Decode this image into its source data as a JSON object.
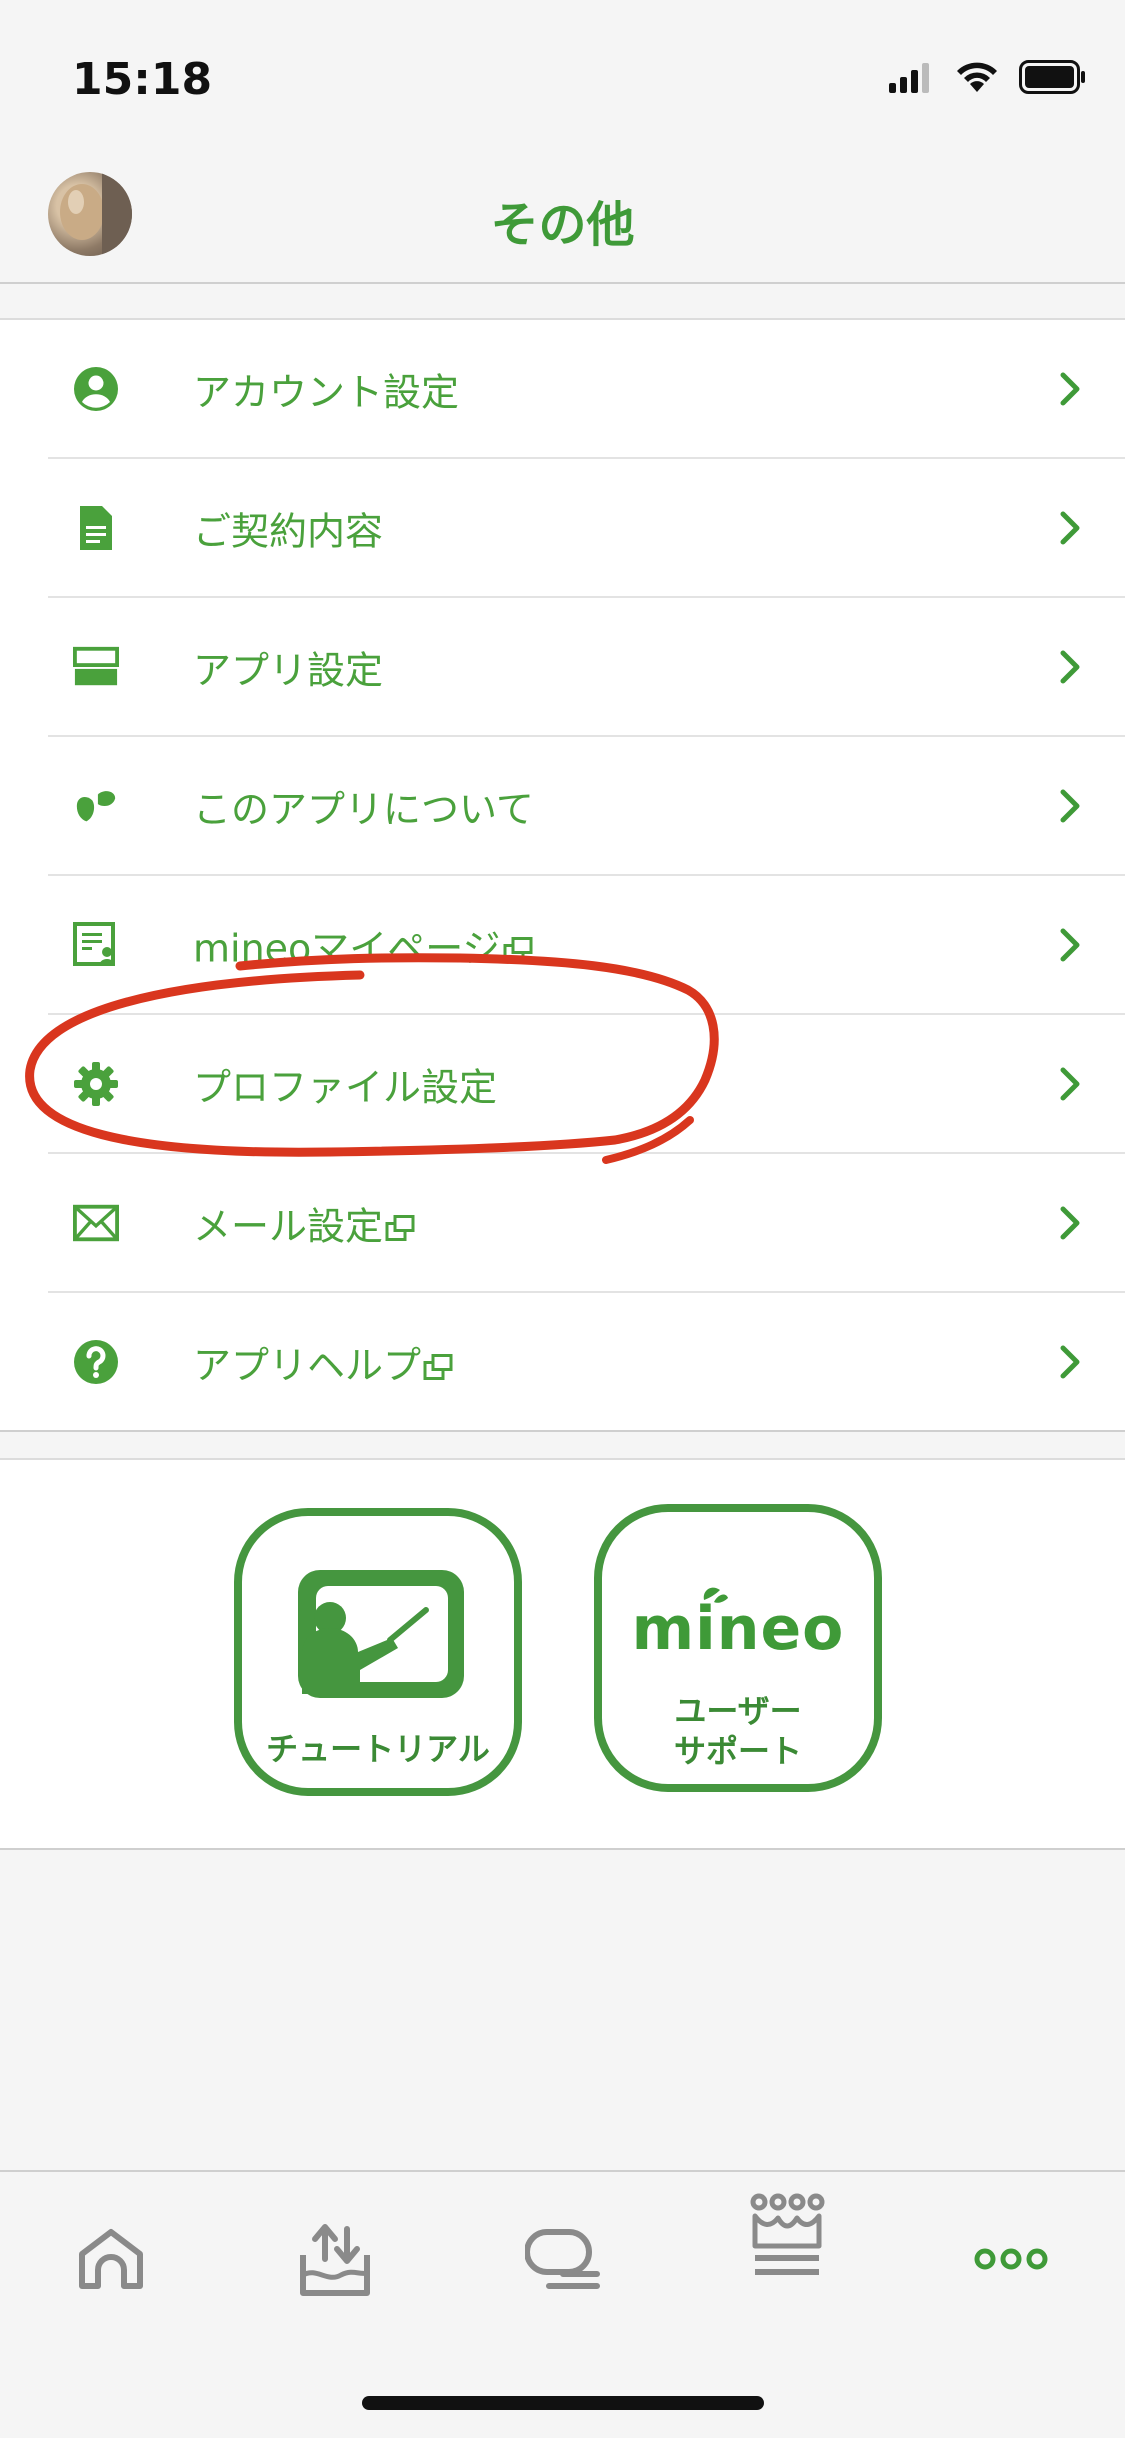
{
  "status_bar": {
    "time": "15:18"
  },
  "header": {
    "title": "その他"
  },
  "menu": {
    "items": [
      {
        "label": "アカウント設定",
        "icon": "account-icon"
      },
      {
        "label": "ご契約内容",
        "icon": "contract-icon"
      },
      {
        "label": "アプリ設定",
        "icon": "app-settings-icon"
      },
      {
        "label": "このアプリについて",
        "icon": "about-app-icon"
      },
      {
        "label": "mineoマイページ",
        "icon": "mypage-icon",
        "external": true
      },
      {
        "label": "プロファイル設定",
        "icon": "gear-icon"
      },
      {
        "label": "メール設定",
        "icon": "mail-icon",
        "external": true
      },
      {
        "label": "アプリヘルプ",
        "icon": "help-icon",
        "external": true
      }
    ]
  },
  "tiles": {
    "tutorial_label": "チュートリアル",
    "support_logo": "mineo",
    "support_label_1": "ユーザー",
    "support_label_2": "サポート"
  },
  "tabbar": {
    "tabs": [
      "home-icon",
      "data-transfer-icon",
      "chat-icon",
      "crown-icon",
      "more-icon"
    ],
    "active_index": 4
  },
  "colors": {
    "brand_green": "#4aa13c",
    "annotation_red": "#d9361e",
    "inactive_icon": "#8a8a8a"
  }
}
